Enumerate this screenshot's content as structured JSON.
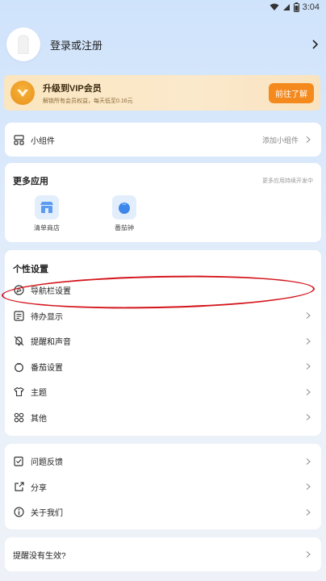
{
  "status": {
    "time": "3:04"
  },
  "profile": {
    "name": "登录或注册"
  },
  "vip": {
    "title": "升级到VIP会员",
    "subtitle": "解锁所有会员权益，每天低至0.16元",
    "button": "前往了解"
  },
  "widgets": {
    "label": "小组件",
    "action": "添加小组件"
  },
  "more_apps": {
    "title": "更多应用",
    "note": "更多应用持续开发中",
    "apps": [
      {
        "label": "清单商店",
        "icon": "store-icon"
      },
      {
        "label": "番茄钟",
        "icon": "tomato-icon"
      }
    ]
  },
  "personal": {
    "title": "个性设置",
    "items": [
      {
        "label": "导航栏设置",
        "icon": "navbar-icon"
      },
      {
        "label": "待办显示",
        "icon": "list-icon"
      },
      {
        "label": "提醒和声音",
        "icon": "bell-icon"
      },
      {
        "label": "番茄设置",
        "icon": "tomato-icon"
      },
      {
        "label": "主题",
        "icon": "shirt-icon"
      },
      {
        "label": "其他",
        "icon": "grid-icon"
      }
    ]
  },
  "support": {
    "items": [
      {
        "label": "问题反馈",
        "icon": "feedback-icon"
      },
      {
        "label": "分享",
        "icon": "share-icon"
      },
      {
        "label": "关于我们",
        "icon": "info-icon"
      }
    ]
  },
  "reminder": {
    "label": "提醒没有生效?"
  },
  "colors": {
    "accent_orange": "#f48a1e",
    "vip_bg": "#fbe6c0",
    "annotation_red": "#d4141b"
  }
}
